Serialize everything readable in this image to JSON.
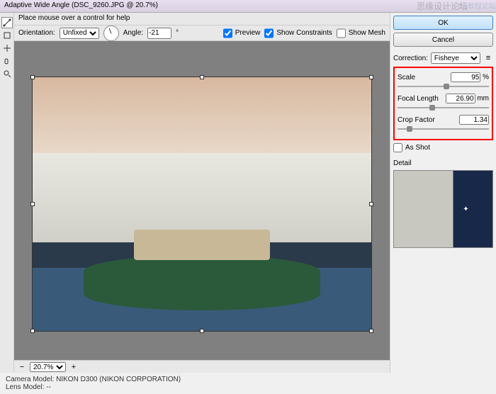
{
  "window": {
    "title": "Adaptive Wide Angle (DSC_9260.JPG @ 20.7%)"
  },
  "watermark": {
    "text1": "思缘设计论坛",
    "text2": "PS教程论坛"
  },
  "help": {
    "hint": "Place mouse over a control for help"
  },
  "options": {
    "orientation_label": "Orientation:",
    "orientation_value": "Unfixed",
    "angle_label": "Angle:",
    "angle_value": "-21",
    "preview_label": "Preview",
    "show_constraints_label": "Show Constraints",
    "show_mesh_label": "Show Mesh"
  },
  "buttons": {
    "ok": "OK",
    "cancel": "Cancel"
  },
  "correction": {
    "label": "Correction:",
    "value": "Fisheye",
    "scale_label": "Scale",
    "scale_value": "95",
    "scale_unit": "%",
    "focal_label": "Focal Length",
    "focal_value": "26.90",
    "focal_unit": "mm",
    "crop_label": "Crop Factor",
    "crop_value": "1.34",
    "asshot_label": "As Shot"
  },
  "detail": {
    "label": "Detail"
  },
  "status": {
    "zoom": "20.7%"
  },
  "footer": {
    "camera_label": "Camera Model:",
    "camera_value": "NIKON D300 (NIKON CORPORATION)",
    "lens_label": "Lens Model:",
    "lens_value": "--"
  },
  "icons": {
    "menu": "≡"
  }
}
